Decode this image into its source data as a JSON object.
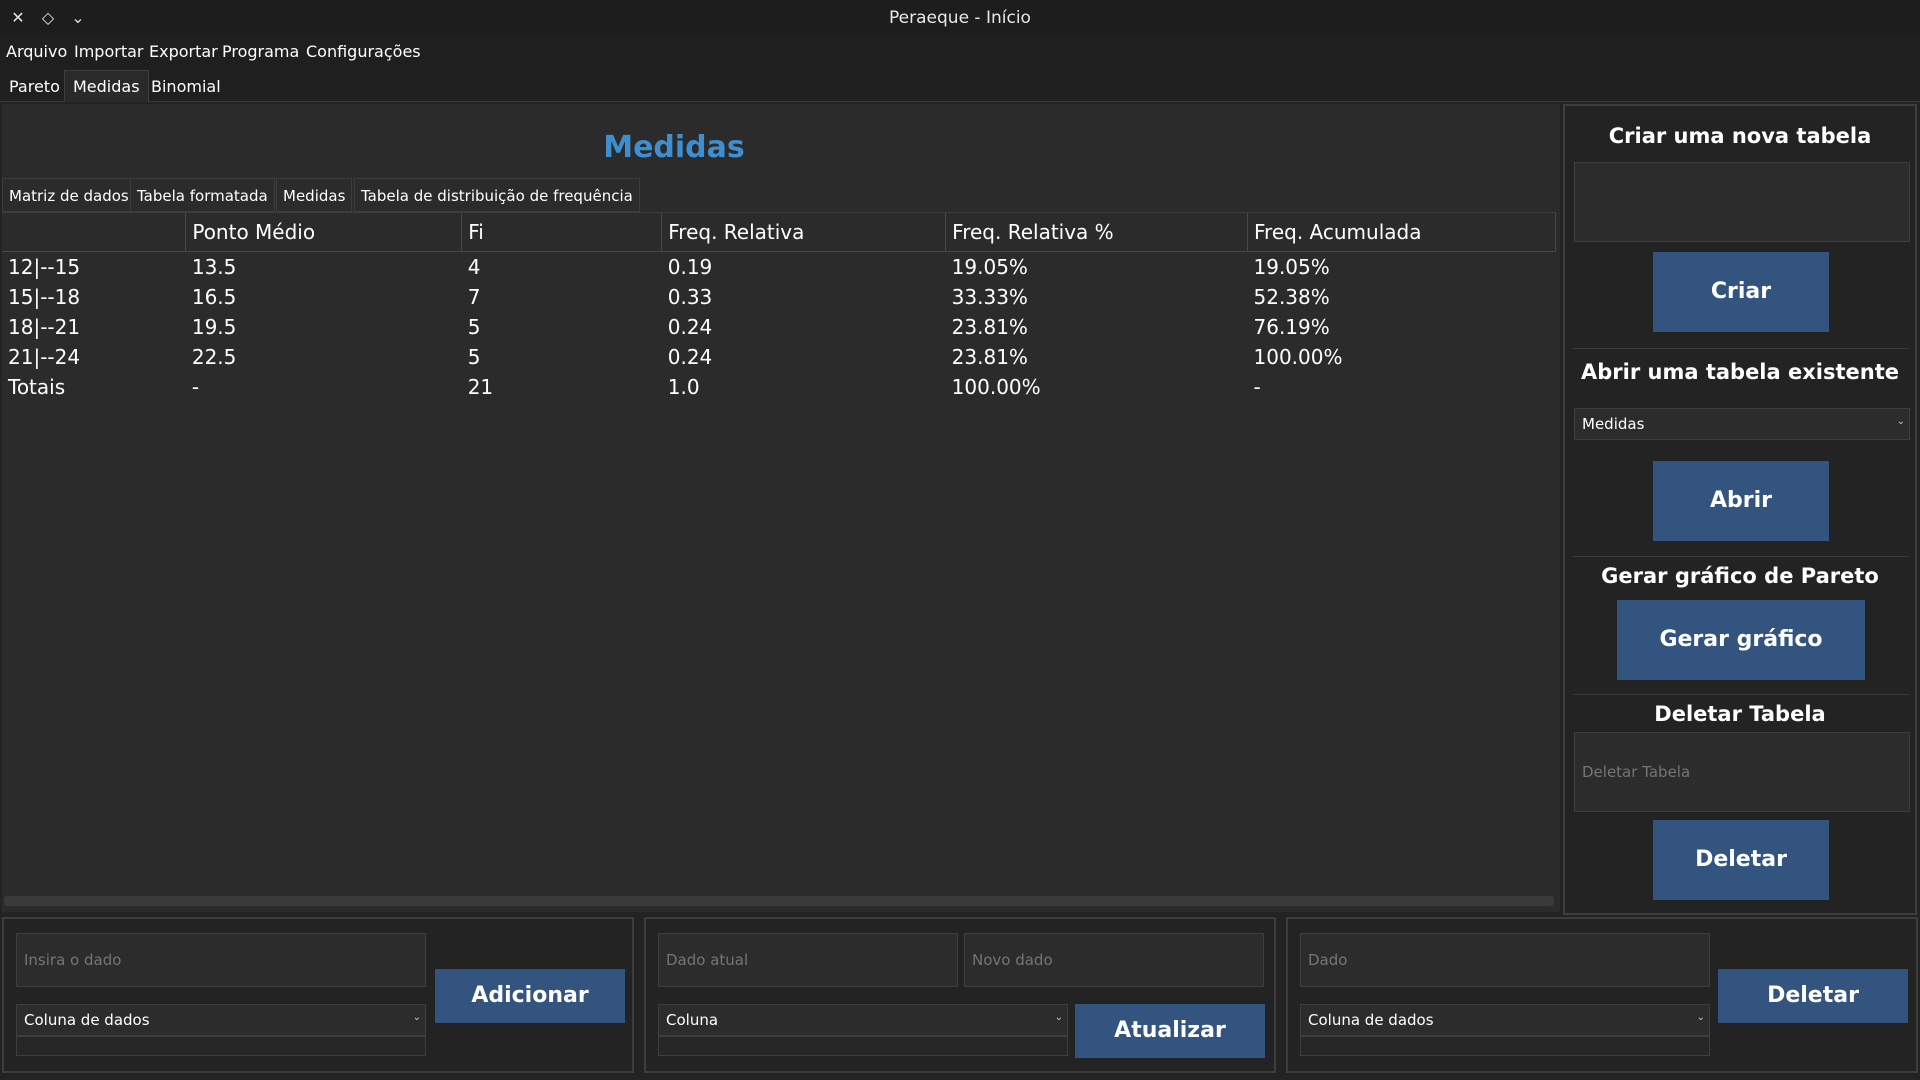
{
  "window": {
    "title": "Peraeque - Início"
  },
  "menu": [
    "Arquivo",
    "Importar",
    "Exportar",
    "Programa",
    "Configurações"
  ],
  "top_tabs": [
    "Pareto",
    "Medidas",
    "Binomial"
  ],
  "page_title": "Medidas",
  "sub_tabs": [
    "Matriz de dados",
    "Tabela formatada",
    "Medidas",
    "Tabela de distribuição de frequência"
  ],
  "table": {
    "headers": [
      "",
      "Ponto Médio",
      "Fi",
      "Freq. Relativa",
      "Freq. Relativa %",
      "Freq. Acumulada"
    ],
    "rows": [
      [
        "12|--15",
        "13.5",
        "4",
        "0.19",
        "19.05%",
        "19.05%"
      ],
      [
        "15|--18",
        "16.5",
        "7",
        "0.33",
        "33.33%",
        "52.38%"
      ],
      [
        "18|--21",
        "19.5",
        "5",
        "0.24",
        "23.81%",
        "76.19%"
      ],
      [
        "21|--24",
        "22.5",
        "5",
        "0.24",
        "23.81%",
        "100.00%"
      ],
      [
        "Totais",
        "-",
        "21",
        "1.0",
        "100.00%",
        "-"
      ]
    ]
  },
  "right_panel": {
    "create": {
      "heading": "Criar uma nova tabela",
      "input_value": "",
      "button": "Criar"
    },
    "open": {
      "heading": "Abrir uma tabela existente",
      "selected": "Medidas",
      "button": "Abrir"
    },
    "pareto": {
      "heading": "Gerar gráfico de Pareto",
      "button": "Gerar gráfico"
    },
    "delete": {
      "heading": "Deletar Tabela",
      "input_placeholder": "Deletar Tabela",
      "button": "Deletar"
    }
  },
  "bottom": {
    "add": {
      "input_placeholder": "Insira o dado",
      "column_select": "Coluna de dados",
      "button": "Adicionar"
    },
    "update": {
      "current_placeholder": "Dado atual",
      "new_placeholder": "Novo dado",
      "column_select": "Coluna",
      "button": "Atualizar"
    },
    "delete": {
      "input_placeholder": "Dado",
      "column_select": "Coluna de dados",
      "button": "Deletar"
    }
  },
  "colors": {
    "accent": "#3d8fd1",
    "button": "#33547f",
    "background": "#232323"
  }
}
